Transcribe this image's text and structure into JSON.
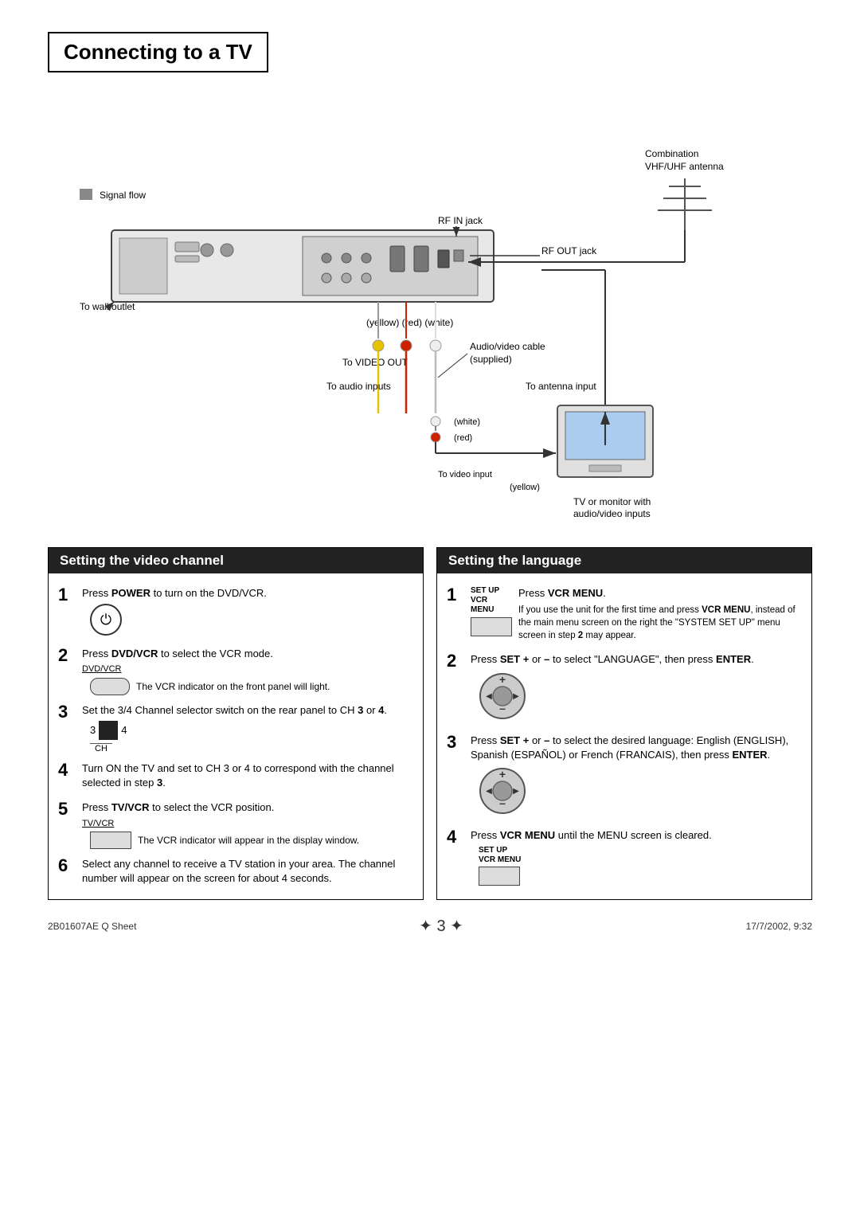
{
  "page": {
    "title": "Connecting to a TV",
    "footer_left": "2B01607AE Q Sheet",
    "footer_center_page": "3",
    "footer_right": "17/7/2002, 9:32"
  },
  "diagram": {
    "labels": {
      "signal_flow": "Signal flow",
      "rf_in_jack": "RF IN jack",
      "rf_out_jack": "RF OUT jack",
      "combination_antenna": "Combination\nVHF/UHF antenna",
      "to_wall_outlet": "To wall outlet",
      "yellow": "(yellow)",
      "red": "(red)",
      "white": "(white)",
      "to_video_out": "To VIDEO OUT",
      "audio_video_cable": "Audio/video cable\n(supplied)",
      "to_audio_inputs": "To audio inputs",
      "to_antenna_input": "To antenna input",
      "white2": "(white)",
      "red2": "(red)",
      "to_video_input": "To video input",
      "yellow2": "(yellow)",
      "tv_or_monitor": "TV or monitor with\naudio/video inputs"
    }
  },
  "video_channel": {
    "heading": "Setting the video channel",
    "steps": [
      {
        "num": "1",
        "text": "Press ",
        "bold": "POWER",
        "text2": " to turn on the DVD/VCR.",
        "icon": "power"
      },
      {
        "num": "2",
        "text": "Press ",
        "bold": "DVD/VCR",
        "text2": " to select the VCR mode.",
        "sub_label": "DVD/VCR",
        "sub_text": "The VCR indicator on the front panel will light.",
        "icon": "dvdvcr"
      },
      {
        "num": "3",
        "text": "Set the 3/4 Channel selector switch on the rear panel to CH ",
        "bold": "3",
        "text2": " or ",
        "bold2": "4",
        "text3": ".",
        "icon": "channel"
      },
      {
        "num": "4",
        "text": "Turn ON the TV and set to CH 3 or 4 to correspond with the channel selected in step ",
        "bold": "3",
        "text2": "."
      },
      {
        "num": "5",
        "text": "Press ",
        "bold": "TV/VCR",
        "text2": " to select the VCR position.",
        "sub_label": "TV/VCR",
        "sub_text": "The VCR indicator will appear in the display window.",
        "icon": "tvvcr"
      },
      {
        "num": "6",
        "text": "Select any channel to receive a TV station in your area. The channel number will appear on the screen for about 4 seconds."
      }
    ]
  },
  "language": {
    "heading": "Setting the language",
    "steps": [
      {
        "num": "1",
        "text": "Press ",
        "bold": "VCR MENU",
        "text2": ".",
        "side_label1": "SET UP",
        "side_label2": "VCR MENU",
        "side_text": "If you use the unit for the first time and press ",
        "side_bold": "VCR MENU",
        "side_text2": ", instead of the main menu screen on the right the \"SYSTEM SET UP\" menu screen in step ",
        "side_bold2": "2",
        "side_text3": " may appear.",
        "icon": "vcrmenu"
      },
      {
        "num": "2",
        "text": "Press ",
        "bold": "SET +",
        "text2": " or ",
        "bold2": "–",
        "text3": " to select \"LANGUAGE\", then press ",
        "bold3": "ENTER",
        "text4": ".",
        "icon": "setbtn"
      },
      {
        "num": "3",
        "text": "Press ",
        "bold": "SET +",
        "text2": " or ",
        "bold2": "–",
        "text3": " to select the desired language: English (ENGLISH), Spanish (ESPAÑOL) or French (FRANCAIS), then press ",
        "bold3": "ENTER",
        "text4": ".",
        "icon": "setbtn2"
      },
      {
        "num": "4",
        "text": "Press ",
        "bold": "VCR MENU",
        "text2": " until the MENU screen is cleared.",
        "side_label1": "SET UP",
        "side_label2": "VCR MENU",
        "icon": "vcrmenu2"
      }
    ]
  }
}
